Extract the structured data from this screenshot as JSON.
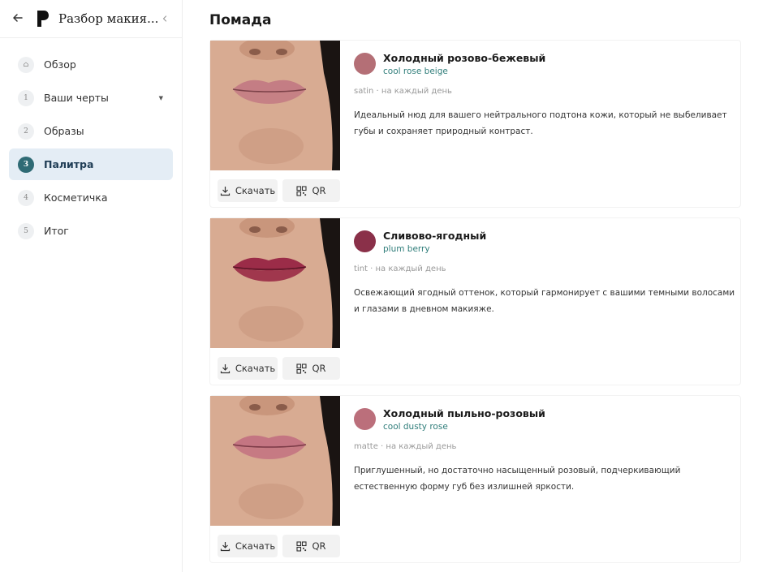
{
  "sidebar": {
    "title": "Разбор макия...",
    "back_icon": "arrow-left-icon",
    "collapse_icon": "chevron-left-icon",
    "items": [
      {
        "marker": "⌂",
        "label": "Обзор"
      },
      {
        "marker": "1",
        "label": "Ваши черты"
      },
      {
        "marker": "2",
        "label": "Образы"
      },
      {
        "marker": "3",
        "label": "Палитра"
      },
      {
        "marker": "4",
        "label": "Косметичка"
      },
      {
        "marker": "5",
        "label": "Итог"
      }
    ],
    "active_index": 3
  },
  "main": {
    "section_title": "Помада",
    "download_label": "Скачать",
    "qr_label": "QR",
    "cards": [
      {
        "name": "Холодный розово-бежевый",
        "name_en": "cool rose beige",
        "meta": "satin · на каждый день",
        "description": "Идеальный нюд для вашего нейтрального подтона кожи, который не выбеливает губы и сохраняет природный контраст.",
        "swatch_color": "#b46f76"
      },
      {
        "name": "Сливово-ягодный",
        "name_en": "plum berry",
        "meta": "tint · на каждый день",
        "description": "Освежающий ягодный оттенок, который гармонирует с вашими темными волосами и глазами в дневном макияже.",
        "swatch_color": "#8a3049"
      },
      {
        "name": "Холодный пыльно-розовый",
        "name_en": "cool dusty rose",
        "meta": "matte · на каждый день",
        "description": "Приглушенный, но достаточно насыщенный розовый, подчеркивающий естественную форму губ без излишней яркости.",
        "swatch_color": "#bb6f7b"
      }
    ]
  },
  "colors": {
    "accent": "#2f6b75",
    "active_bg": "#e4edf5",
    "english_name": "#2f7d7a",
    "lip_1": "#c47d84",
    "lip_2": "#9b2c48",
    "lip_3": "#c47582"
  }
}
